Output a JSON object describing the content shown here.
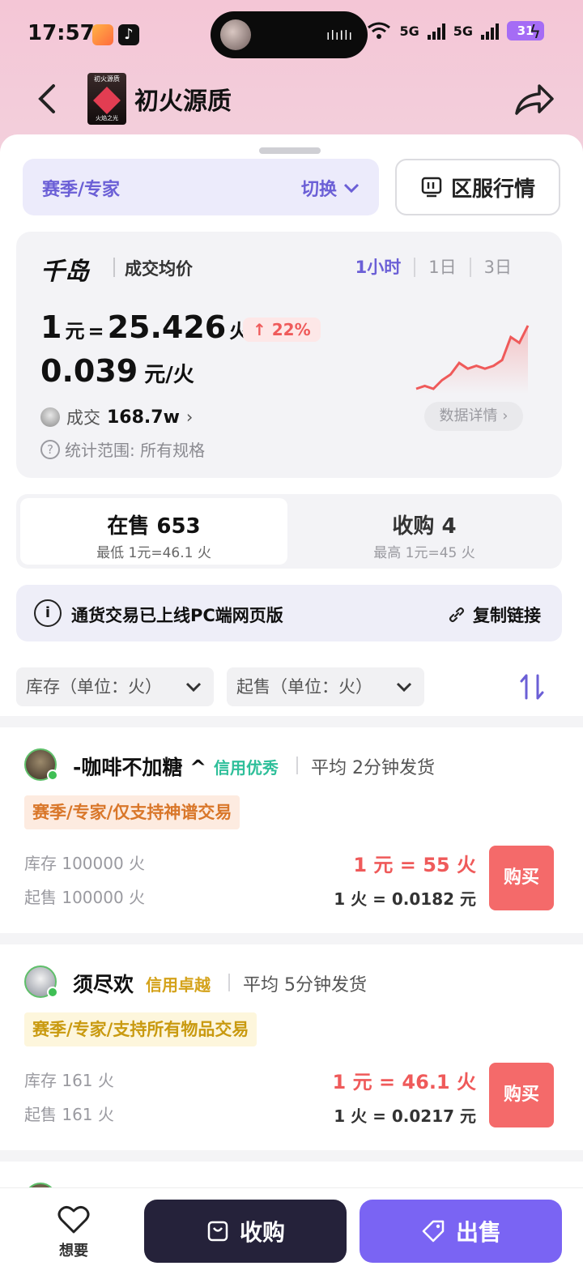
{
  "status_bar": {
    "time": "17:57",
    "net1": "5G",
    "net2": "5G",
    "battery": "31"
  },
  "nav": {
    "title": "初火源质",
    "logo_top": "初火源质",
    "logo_bottom": "火焰之光"
  },
  "season": {
    "label": "赛季/专家",
    "switch_label": "切换"
  },
  "region_button": "区服行情",
  "price_card": {
    "brand": "千岛",
    "avg_label": "成交均价",
    "range_tabs": [
      "1小时",
      "1日",
      "3日"
    ],
    "active_range": "1小时",
    "rate_lhs": "1",
    "rate_yuan": "元",
    "rate_eq": "=",
    "rate_value": "25.426",
    "rate_unit": "火",
    "change": "22%",
    "unit_price": "0.039",
    "unit_price_label": "元/火",
    "deal_label": "成交",
    "deal_value": "168.7w",
    "scope": "统计范围: 所有规格",
    "detail_button": "数据详情"
  },
  "trend_chart": {
    "type": "line",
    "values": [
      2,
      3,
      2,
      5,
      7,
      11,
      9,
      10,
      9,
      10,
      12,
      20,
      18,
      24
    ]
  },
  "sale_tabs": [
    {
      "label": "在售 653",
      "sub": "最低 1元=46.1 火"
    },
    {
      "label": "收购 4",
      "sub": "最高 1元=45 火"
    }
  ],
  "notice": {
    "text": "通货交易已上线PC端网页版",
    "copy_link": "复制链接"
  },
  "filters": {
    "stock": "库存（单位：火）",
    "min_sale": "起售（单位：火）"
  },
  "listings": [
    {
      "name": "-咖啡不加糖 ^",
      "credit": "信用优秀",
      "credit_color": "#2fbf9a",
      "ship": "平均 2分钟发货",
      "tag": "赛季/专家/仅支持神谱交易",
      "tag_color": "#d9772a",
      "tag_bg": "#fdebe0",
      "stock": "库存 100000 火",
      "min_sale": "起售 100000 火",
      "rate": "1 元 = 55 火",
      "unit": "1 火 = 0.0182 元",
      "buy": "购买"
    },
    {
      "name": "须尽欢",
      "credit": "信用卓越",
      "credit_color": "#d4a21a",
      "ship": "平均 5分钟发货",
      "tag": "赛季/专家/支持所有物品交易",
      "tag_color": "#c99a10",
      "tag_bg": "#fdf6dc",
      "stock": "库存 161 火",
      "min_sale": "起售 161 火",
      "rate": "1 元 = 46.1 火",
      "unit": "1 火 = 0.0217 元",
      "buy": "购买"
    }
  ],
  "bottom_bar": {
    "want": "想要",
    "buy": "收购",
    "sell": "出售"
  },
  "colors": {
    "accent": "#6b5fd6",
    "sell": "#7a64f3",
    "buy_dark": "#25223a",
    "red": "#ef5a5a"
  }
}
